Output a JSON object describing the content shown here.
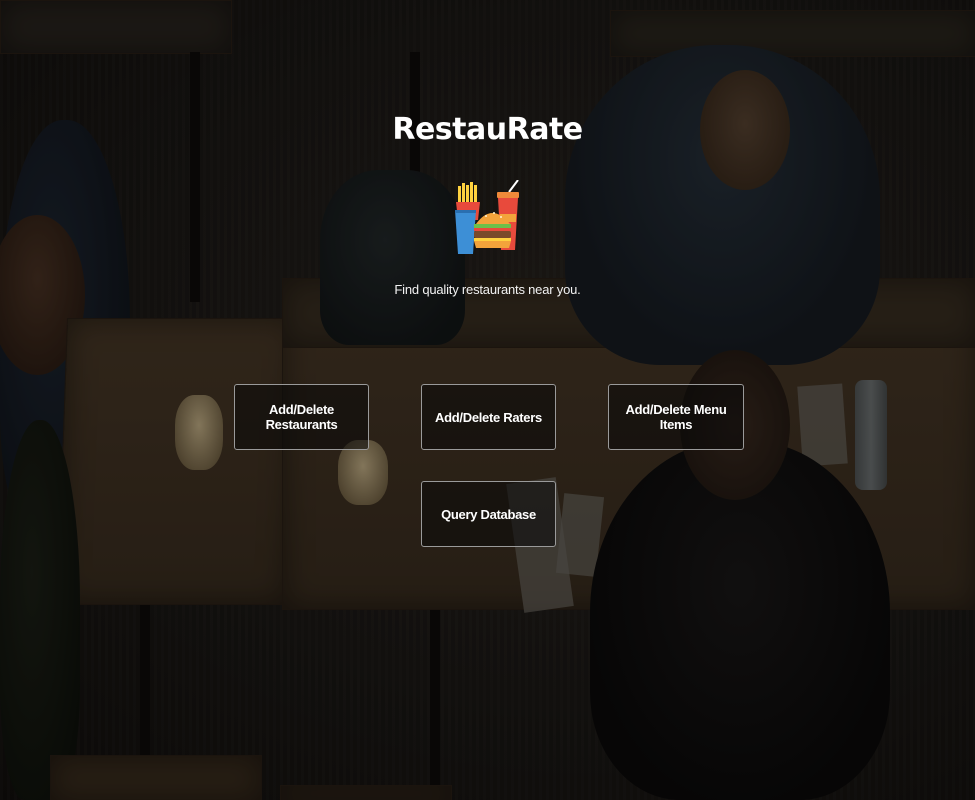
{
  "app": {
    "title": "RestauRate",
    "tagline": "Find quality restaurants near you."
  },
  "logo": {
    "icon": "fast-food-icon"
  },
  "actions": {
    "add_delete_restaurants": "Add/Delete Restaurants",
    "add_delete_raters": "Add/Delete Raters",
    "add_delete_menu_items": "Add/Delete Menu Items",
    "query_database": "Query Database"
  },
  "colors": {
    "text": "#ffffff",
    "button_border": "#9a9a9a",
    "button_fill": "rgba(10,10,10,0.55)",
    "fries_box": "#e84a3c",
    "cup": "#3d8fd6",
    "burger_bun": "#f3a33b"
  }
}
